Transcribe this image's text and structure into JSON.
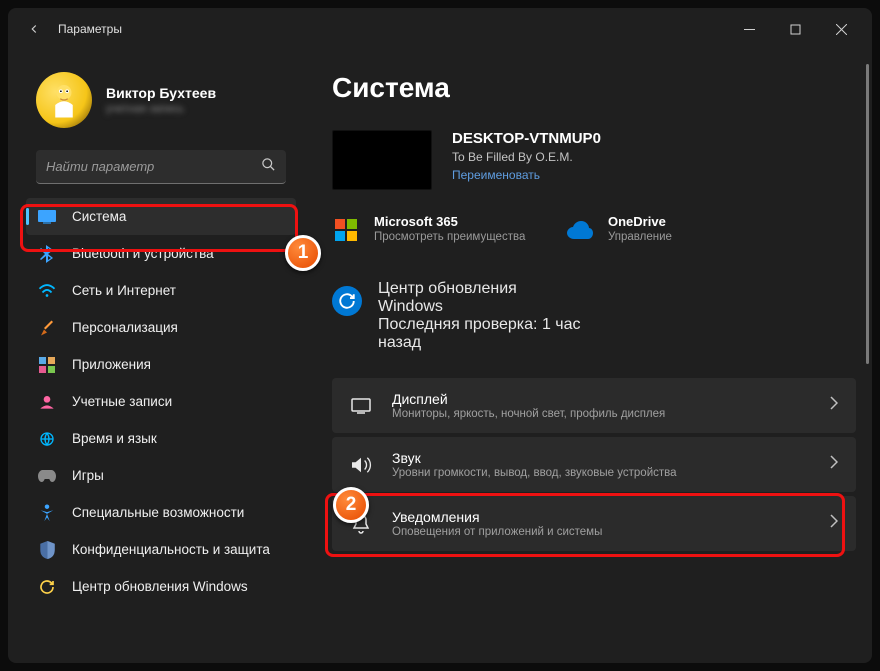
{
  "window": {
    "title": "Параметры"
  },
  "profile": {
    "name": "Виктор Бухтеев",
    "sub": "учетная запись"
  },
  "search": {
    "placeholder": "Найти параметр"
  },
  "sidebar": {
    "items": [
      {
        "label": "Система"
      },
      {
        "label": "Bluetooth и устройства"
      },
      {
        "label": "Сеть и Интернет"
      },
      {
        "label": "Персонализация"
      },
      {
        "label": "Приложения"
      },
      {
        "label": "Учетные записи"
      },
      {
        "label": "Время и язык"
      },
      {
        "label": "Игры"
      },
      {
        "label": "Специальные возможности"
      },
      {
        "label": "Конфиденциальность и защита"
      },
      {
        "label": "Центр обновления Windows"
      }
    ]
  },
  "content": {
    "heading": "Система",
    "device": {
      "name": "DESKTOP-VTNMUP0",
      "sub": "To Be Filled By O.E.M.",
      "rename": "Переименовать"
    },
    "tiles": [
      {
        "name": "Microsoft 365",
        "sub": "Просмотреть преимущества"
      },
      {
        "name": "OneDrive",
        "sub": "Управление"
      }
    ],
    "update": {
      "name": "Центр обновления Windows",
      "sub": "Последняя проверка: 1 час назад"
    },
    "list": [
      {
        "name": "Дисплей",
        "sub": "Мониторы, яркость, ночной свет, профиль дисплея"
      },
      {
        "name": "Звук",
        "sub": "Уровни громкости, вывод, ввод, звуковые устройства"
      },
      {
        "name": "Уведомления",
        "sub": "Оповещения от приложений и системы"
      }
    ]
  },
  "markers": {
    "one": "1",
    "two": "2"
  }
}
